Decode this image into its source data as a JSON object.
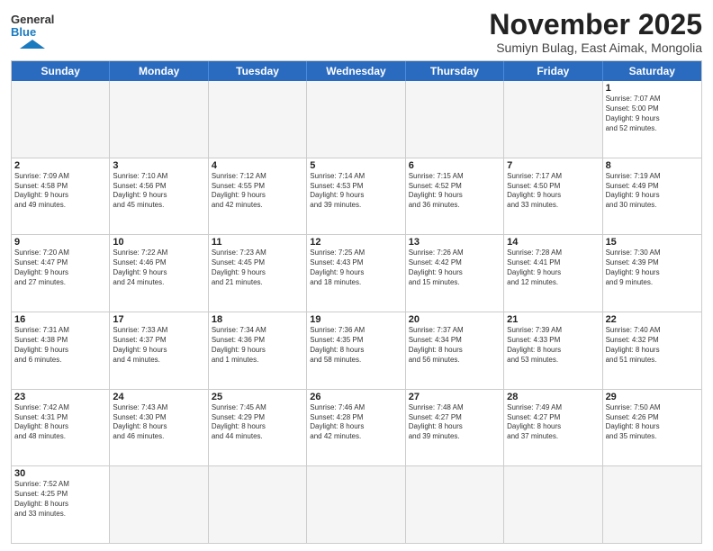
{
  "header": {
    "logo_text_black": "General",
    "logo_text_blue": "Blue",
    "month_title": "November 2025",
    "subtitle": "Sumiyn Bulag, East Aimak, Mongolia"
  },
  "calendar": {
    "days_of_week": [
      "Sunday",
      "Monday",
      "Tuesday",
      "Wednesday",
      "Thursday",
      "Friday",
      "Saturday"
    ],
    "weeks": [
      [
        {
          "day": "",
          "empty": true
        },
        {
          "day": "",
          "empty": true
        },
        {
          "day": "",
          "empty": true
        },
        {
          "day": "",
          "empty": true
        },
        {
          "day": "",
          "empty": true
        },
        {
          "day": "",
          "empty": true
        },
        {
          "day": "1",
          "sunrise": "7:07 AM",
          "sunset": "5:00 PM",
          "daylight_hours": "9",
          "daylight_minutes": "52"
        }
      ],
      [
        {
          "day": "2",
          "sunrise": "7:09 AM",
          "sunset": "4:58 PM",
          "daylight_hours": "9",
          "daylight_minutes": "49"
        },
        {
          "day": "3",
          "sunrise": "7:10 AM",
          "sunset": "4:56 PM",
          "daylight_hours": "9",
          "daylight_minutes": "45"
        },
        {
          "day": "4",
          "sunrise": "7:12 AM",
          "sunset": "4:55 PM",
          "daylight_hours": "9",
          "daylight_minutes": "42"
        },
        {
          "day": "5",
          "sunrise": "7:14 AM",
          "sunset": "4:53 PM",
          "daylight_hours": "9",
          "daylight_minutes": "39"
        },
        {
          "day": "6",
          "sunrise": "7:15 AM",
          "sunset": "4:52 PM",
          "daylight_hours": "9",
          "daylight_minutes": "36"
        },
        {
          "day": "7",
          "sunrise": "7:17 AM",
          "sunset": "4:50 PM",
          "daylight_hours": "9",
          "daylight_minutes": "33"
        },
        {
          "day": "8",
          "sunrise": "7:19 AM",
          "sunset": "4:49 PM",
          "daylight_hours": "9",
          "daylight_minutes": "30"
        }
      ],
      [
        {
          "day": "9",
          "sunrise": "7:20 AM",
          "sunset": "4:47 PM",
          "daylight_hours": "9",
          "daylight_minutes": "27"
        },
        {
          "day": "10",
          "sunrise": "7:22 AM",
          "sunset": "4:46 PM",
          "daylight_hours": "9",
          "daylight_minutes": "24"
        },
        {
          "day": "11",
          "sunrise": "7:23 AM",
          "sunset": "4:45 PM",
          "daylight_hours": "9",
          "daylight_minutes": "21"
        },
        {
          "day": "12",
          "sunrise": "7:25 AM",
          "sunset": "4:43 PM",
          "daylight_hours": "9",
          "daylight_minutes": "18"
        },
        {
          "day": "13",
          "sunrise": "7:26 AM",
          "sunset": "4:42 PM",
          "daylight_hours": "9",
          "daylight_minutes": "15"
        },
        {
          "day": "14",
          "sunrise": "7:28 AM",
          "sunset": "4:41 PM",
          "daylight_hours": "9",
          "daylight_minutes": "12"
        },
        {
          "day": "15",
          "sunrise": "7:30 AM",
          "sunset": "4:39 PM",
          "daylight_hours": "9",
          "daylight_minutes": "9"
        }
      ],
      [
        {
          "day": "16",
          "sunrise": "7:31 AM",
          "sunset": "4:38 PM",
          "daylight_hours": "9",
          "daylight_minutes": "6"
        },
        {
          "day": "17",
          "sunrise": "7:33 AM",
          "sunset": "4:37 PM",
          "daylight_hours": "9",
          "daylight_minutes": "4"
        },
        {
          "day": "18",
          "sunrise": "7:34 AM",
          "sunset": "4:36 PM",
          "daylight_hours": "9",
          "daylight_minutes": "1"
        },
        {
          "day": "19",
          "sunrise": "7:36 AM",
          "sunset": "4:35 PM",
          "daylight_hours": "8",
          "daylight_minutes": "58"
        },
        {
          "day": "20",
          "sunrise": "7:37 AM",
          "sunset": "4:34 PM",
          "daylight_hours": "8",
          "daylight_minutes": "56"
        },
        {
          "day": "21",
          "sunrise": "7:39 AM",
          "sunset": "4:33 PM",
          "daylight_hours": "8",
          "daylight_minutes": "53"
        },
        {
          "day": "22",
          "sunrise": "7:40 AM",
          "sunset": "4:32 PM",
          "daylight_hours": "8",
          "daylight_minutes": "51"
        }
      ],
      [
        {
          "day": "23",
          "sunrise": "7:42 AM",
          "sunset": "4:31 PM",
          "daylight_hours": "8",
          "daylight_minutes": "48"
        },
        {
          "day": "24",
          "sunrise": "7:43 AM",
          "sunset": "4:30 PM",
          "daylight_hours": "8",
          "daylight_minutes": "46"
        },
        {
          "day": "25",
          "sunrise": "7:45 AM",
          "sunset": "4:29 PM",
          "daylight_hours": "8",
          "daylight_minutes": "44"
        },
        {
          "day": "26",
          "sunrise": "7:46 AM",
          "sunset": "4:28 PM",
          "daylight_hours": "8",
          "daylight_minutes": "42"
        },
        {
          "day": "27",
          "sunrise": "7:48 AM",
          "sunset": "4:27 PM",
          "daylight_hours": "8",
          "daylight_minutes": "39"
        },
        {
          "day": "28",
          "sunrise": "7:49 AM",
          "sunset": "4:27 PM",
          "daylight_hours": "8",
          "daylight_minutes": "37"
        },
        {
          "day": "29",
          "sunrise": "7:50 AM",
          "sunset": "4:26 PM",
          "daylight_hours": "8",
          "daylight_minutes": "35"
        }
      ],
      [
        {
          "day": "30",
          "sunrise": "7:52 AM",
          "sunset": "4:25 PM",
          "daylight_hours": "8",
          "daylight_minutes": "33"
        },
        {
          "day": "",
          "empty": true
        },
        {
          "day": "",
          "empty": true
        },
        {
          "day": "",
          "empty": true
        },
        {
          "day": "",
          "empty": true
        },
        {
          "day": "",
          "empty": true
        },
        {
          "day": "",
          "empty": true
        }
      ]
    ]
  }
}
